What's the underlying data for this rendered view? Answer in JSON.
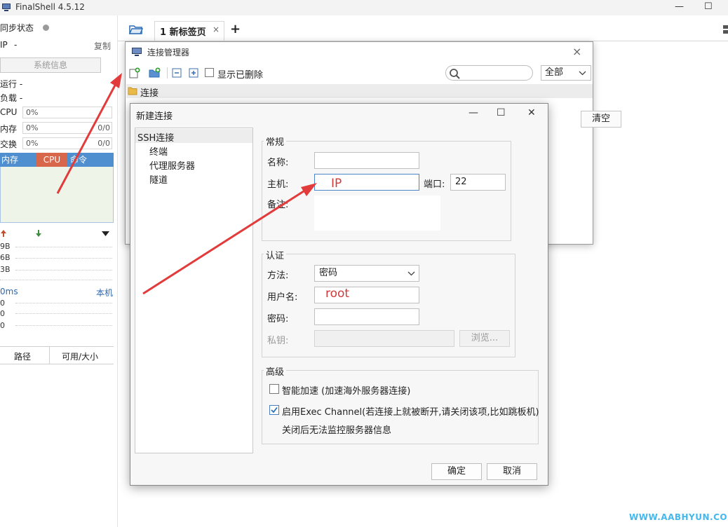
{
  "app": {
    "title": "FinalShell 4.5.12",
    "window_controls": {
      "minimize": "—",
      "maximize": "☐"
    }
  },
  "sidebar": {
    "sync_status": "同步状态",
    "ip_label": "IP",
    "ip_value": "-",
    "copy_label": "复制",
    "sysinfo_button": "系统信息",
    "running_label": "运行 -",
    "load_label": "负载 -",
    "meters": [
      {
        "label": "CPU",
        "value": "0%",
        "extra": ""
      },
      {
        "label": "内存",
        "value": "0%",
        "extra": "0/0"
      },
      {
        "label": "交换",
        "value": "0%",
        "extra": "0/0"
      }
    ],
    "process_columns": [
      "内存",
      "CPU",
      "命令"
    ],
    "net_rows": [
      "9B",
      "6B",
      "3B"
    ],
    "latency_label": "0ms",
    "local_label": "本机",
    "latency_rows": [
      "0",
      "0",
      "0"
    ],
    "file_columns": [
      "路径",
      "可用/大小"
    ]
  },
  "tabs": {
    "items": [
      {
        "label": "1 新标签页",
        "close": "×"
      }
    ],
    "add_label": "+"
  },
  "conn_manager": {
    "title": "连接管理器",
    "close": "×",
    "show_deleted_label": "显示已删除",
    "filter_value": "全部",
    "tree_root": "连接",
    "clear_button": "清空"
  },
  "new_conn": {
    "title": "新建连接",
    "controls": {
      "minimize": "—",
      "maximize": "☐",
      "close": "✕"
    },
    "nav": [
      {
        "label": "SSH连接"
      },
      {
        "label": "终端"
      },
      {
        "label": "代理服务器"
      },
      {
        "label": "隧道"
      }
    ],
    "general": {
      "title": "常规",
      "name_label": "名称:",
      "name_value": "",
      "host_label": "主机:",
      "host_value": "",
      "port_label": "端口:",
      "port_value": "22",
      "note_label": "备注:"
    },
    "auth": {
      "title": "认证",
      "method_label": "方法:",
      "method_value": "密码",
      "user_label": "用户名:",
      "user_value": "",
      "password_label": "密码:",
      "password_value": "",
      "key_label": "私钥:",
      "browse_button": "浏览..."
    },
    "advanced": {
      "title": "高级",
      "smart_accel_label": "智能加速 (加速海外服务器连接)",
      "smart_accel_checked": false,
      "exec_channel_label": "启用Exec Channel(若连接上就被断开,请关闭该项,比如跳板机)",
      "exec_channel_checked": true,
      "exec_channel_note": "关闭后无法监控服务器信息"
    },
    "ok_button": "确定",
    "cancel_button": "取消"
  },
  "annotations": {
    "ip_text": "IP",
    "root_text": "root",
    "arrow_color": "#e23b3b",
    "text_color": "#d23a3a"
  },
  "watermark": "WWW.AABHYUN.COM"
}
